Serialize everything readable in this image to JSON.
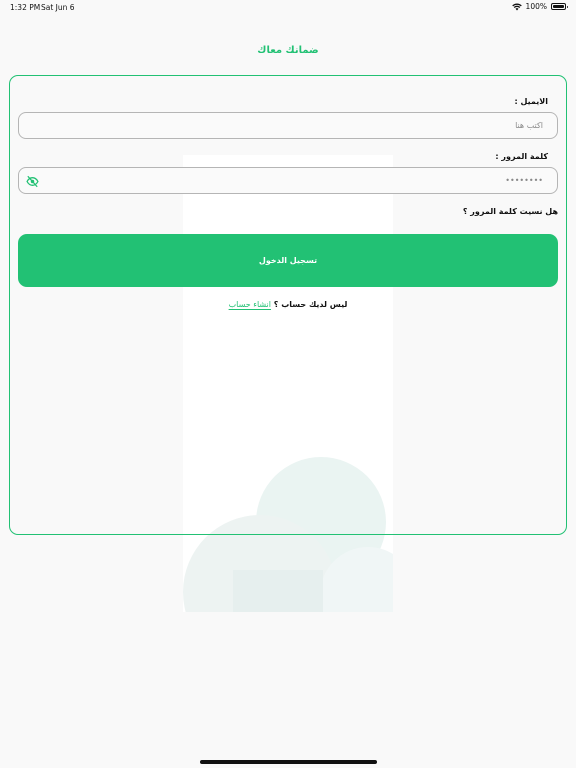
{
  "status_bar": {
    "time": "1:32 PM",
    "date": "Sat Jun 6",
    "battery": "100%",
    "wifi_icon": "wifi-icon",
    "battery_icon": "battery-icon"
  },
  "header": {
    "title": "ضمانك معاك"
  },
  "form": {
    "email_label": "الايميل :",
    "email_placeholder": "اكتب هنا",
    "email_value": "",
    "password_label": "كلمة المرور :",
    "password_value": "••••••••",
    "password_toggle_icon": "eye-off-icon",
    "forgot_password": "هل نسيت كلمة المرور ؟",
    "login_button": "تسجيل الدخول",
    "no_account_text": "ليس لديك حساب ؟ ",
    "create_account_link": "انشاء حساب"
  },
  "colors": {
    "accent": "#22c174",
    "background": "#f9f9f9",
    "input_border": "#b5b5b5"
  }
}
